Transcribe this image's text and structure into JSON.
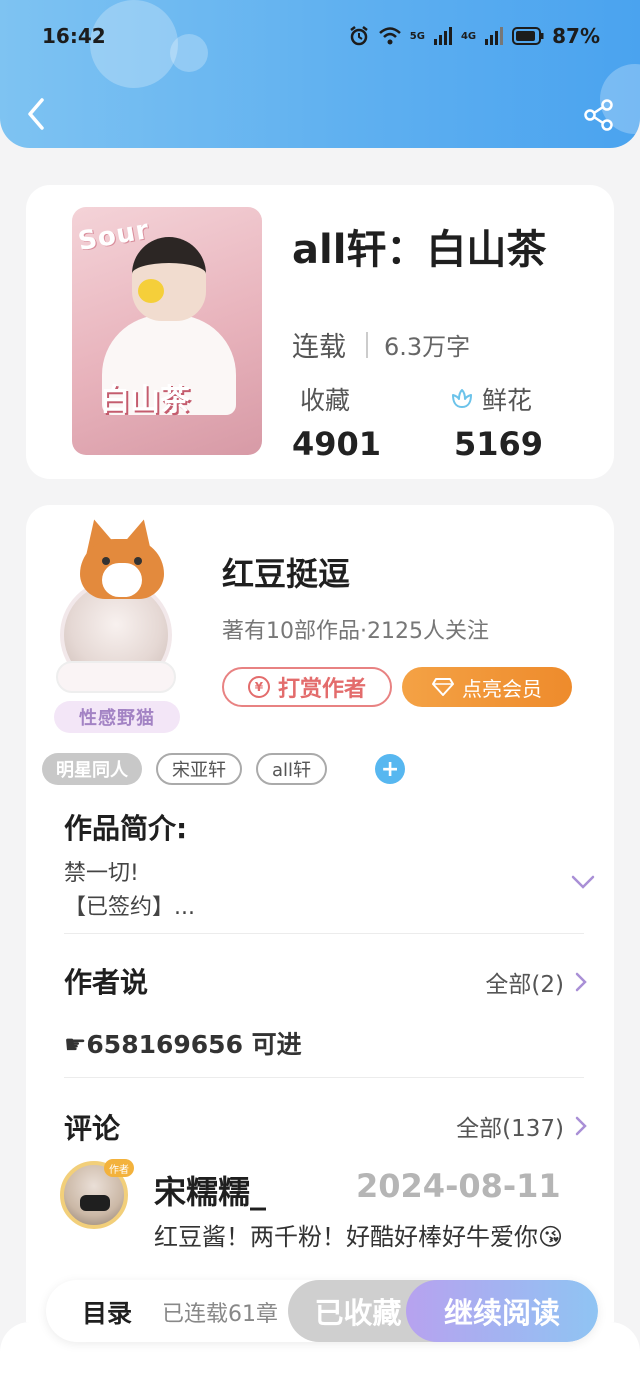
{
  "status_bar": {
    "time": "16:42",
    "battery": "87%",
    "signal_5g": "5G",
    "signal_4g": "4G"
  },
  "book": {
    "title": "all轩：白山茶",
    "status": "连载",
    "word_count": "6.3万字",
    "favorites_label": "收藏",
    "favorites_value": "4901",
    "flowers_label": "鲜花",
    "flowers_value": "5169",
    "cover_text": "Sour",
    "cover_tag": "白山茶"
  },
  "author": {
    "name": "红豆挺逗",
    "stats": "著有10部作品·2125人关注",
    "tip_label": "打赏作者",
    "tip_symbol": "¥",
    "vip_label": "点亮会员",
    "avatar_badge": "性感野猫"
  },
  "tags": [
    "明星同人",
    "宋亚轩",
    "all轩"
  ],
  "intro": {
    "title": "作品简介:",
    "line1": "禁一切!",
    "line2": "【已签约】..."
  },
  "author_says": {
    "title": "作者说",
    "more_label": "全部(2)",
    "text": "☛658169656 可进"
  },
  "comments": {
    "title": "评论",
    "more_label": "全部(137)",
    "items": [
      {
        "user": "宋糯糯_",
        "date": "2024-08-11",
        "badge": "作者",
        "text": "红豆酱！两千粉！好酷好棒好牛爱你😘"
      }
    ]
  },
  "bottom_bar": {
    "toc_label": "目录",
    "serial_label": "已连载61章",
    "collected_label": "已收藏",
    "read_label": "继续阅读"
  },
  "colors": {
    "header": "#5fb0f0",
    "vip": "#f09a3a",
    "tip": "#e36c6c",
    "read_btn": "#a9b3f1"
  }
}
